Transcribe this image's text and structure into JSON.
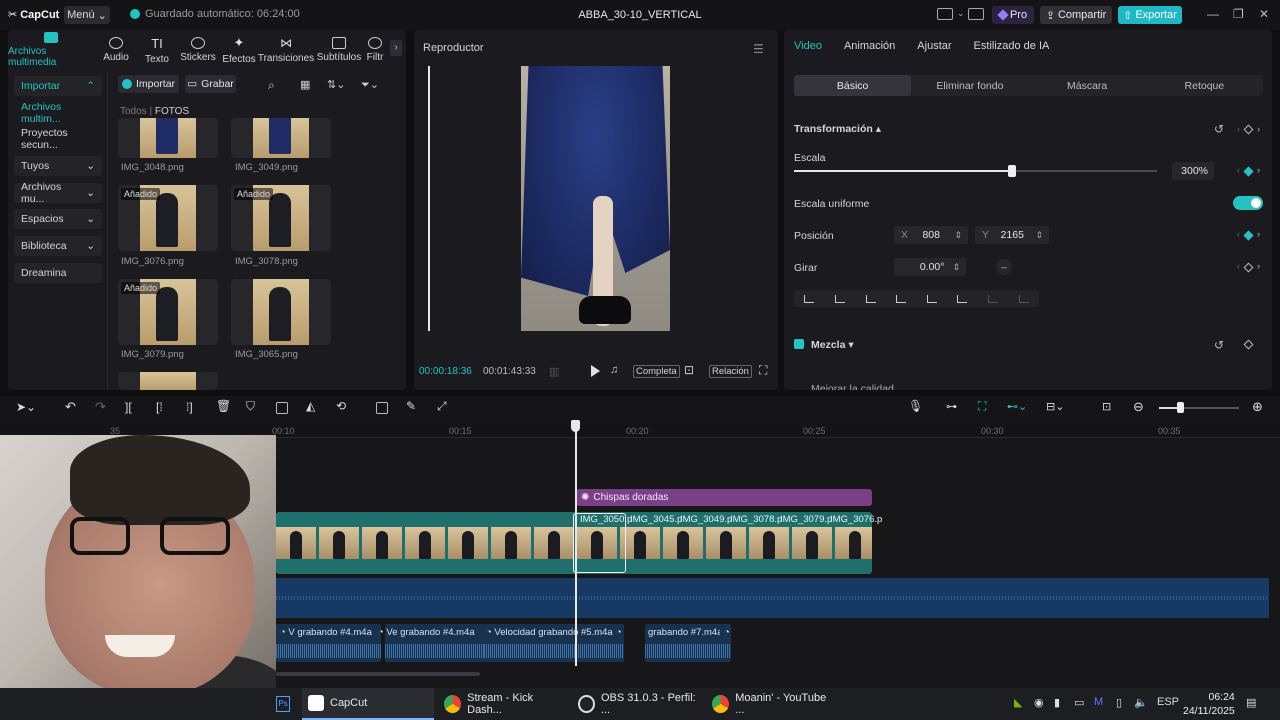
{
  "titlebar": {
    "logo": "CapCut",
    "menu": "Menú",
    "autosave": "Guardado automático: 06:24:00",
    "project_title": "ABBA_30-10_VERTICAL",
    "pro": "Pro",
    "share": "Compartir",
    "export": "Exportar"
  },
  "media_tabs": [
    {
      "label": "Archivos multimedia",
      "active": true
    },
    {
      "label": "Audio"
    },
    {
      "label": "Texto"
    },
    {
      "label": "Stickers"
    },
    {
      "label": "Efectos"
    },
    {
      "label": "Transiciones"
    },
    {
      "label": "Subtítulos"
    },
    {
      "label": "Filtr"
    }
  ],
  "sidebar": {
    "items": [
      {
        "label": "Importar",
        "chevron": "⌃"
      },
      {
        "label": "Archivos multim..."
      },
      {
        "label": "Proyectos secun..."
      },
      {
        "label": "Tuyos",
        "chevron": "⌄"
      },
      {
        "label": "Archivos mu...",
        "chevron": "⌄"
      },
      {
        "label": "Espacios",
        "chevron": "⌄"
      },
      {
        "label": "Biblioteca",
        "chevron": "⌄"
      },
      {
        "label": "Dreamina"
      }
    ]
  },
  "media": {
    "import_btn": "Importar",
    "record_btn": "Grabar",
    "crumb_all": "Todos",
    "crumb_sep": "|",
    "crumb_current": "FOTOS",
    "thumbs": [
      {
        "label": "IMG_3048.png",
        "badge": ""
      },
      {
        "label": "IMG_3049.png",
        "badge": ""
      },
      {
        "label": "IMG_3076.png",
        "badge": "Añadido"
      },
      {
        "label": "IMG_3078.png",
        "badge": "Añadido"
      },
      {
        "label": "IMG_3079.png",
        "badge": "Añadido"
      },
      {
        "label": "IMG_3065.png",
        "badge": ""
      }
    ]
  },
  "player": {
    "title": "Reproductor",
    "current_time": "00:00:18:36",
    "total_time": "00:01:43:33",
    "full": "Completa",
    "ratio": "Relación"
  },
  "inspector": {
    "tabs": [
      "Video",
      "Animación",
      "Ajustar",
      "Estilizado de IA"
    ],
    "subtabs": [
      "Básico",
      "Eliminar fondo",
      "Máscara",
      "Retoque"
    ],
    "transform_label": "Transformación",
    "scale_label": "Escala",
    "scale_value": "300%",
    "scale_level": 0.6,
    "uniform_label": "Escala uniforme",
    "position_label": "Posición",
    "pos_x_label": "X",
    "pos_x": "808",
    "pos_y_label": "Y",
    "pos_y": "2165",
    "rotate_label": "Girar",
    "rotate_value": "0.00°",
    "blend_label": "Mezcla",
    "quality_label": "Mejorar la calidad"
  },
  "timeline": {
    "ticks": [
      "35",
      "00:10",
      "00:15",
      "00:20",
      "00:25",
      "00:30",
      "00:35"
    ],
    "effect_clip": "Chispas doradas",
    "clips": [
      "IMG_3050.p",
      "IMG_3045.p",
      "IMG_3049.p",
      "IMG_3078.p",
      "IMG_3079.p",
      "IMG_3076.p"
    ],
    "audio_clips": [
      {
        "prefix": "V",
        "label": "grabando #4.m4a"
      },
      {
        "prefix": "Ve",
        "label": "grabando #4.m4a"
      },
      {
        "prefix": "Velocidad",
        "label": "grabando #5.m4a"
      },
      {
        "prefix": "",
        "label": "grabando #7.m4a"
      }
    ]
  },
  "taskbar": {
    "tasks": [
      {
        "label": "CapCut",
        "active": true
      },
      {
        "label": "Stream - Kick Dash..."
      },
      {
        "label": "OBS 31.0.3 - Perfil: ..."
      },
      {
        "label": "Moanin' - YouTube ..."
      }
    ],
    "language": "ESP",
    "time": "06:24",
    "date": "24/11/2025"
  },
  "colors": {
    "accent": "#22c3c1",
    "effect_clip": "#7a3f86",
    "video_track": "#1f6f6c",
    "audio_track": "#163a63"
  }
}
